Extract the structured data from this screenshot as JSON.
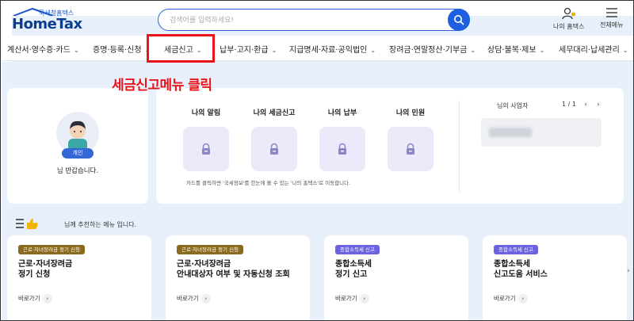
{
  "header": {
    "logo_sub": "국세청홈택스",
    "logo_main": "HomeTax",
    "search_placeholder": "검색어를 입력하세요!",
    "my_hometax": "나의 홈택스",
    "all_menu": "전체메뉴"
  },
  "nav": {
    "items": [
      {
        "label": "계산서·영수증·카드"
      },
      {
        "label": "증명·등록·신청"
      },
      {
        "label": "세금신고"
      },
      {
        "label": "납부·고지·환급"
      },
      {
        "label": "지급명세·자료·공익법인"
      },
      {
        "label": "장려금·연말정산·기부금"
      },
      {
        "label": "상담·불복·제보"
      },
      {
        "label": "세무대리·납세관리"
      }
    ]
  },
  "annotation": "세금신고메뉴 클릭",
  "profile": {
    "badge": "개인",
    "greeting": "님 반갑습니다."
  },
  "info": {
    "cols": [
      {
        "title": "나의 알림"
      },
      {
        "title": "나의 세금신고"
      },
      {
        "title": "나의 납부"
      },
      {
        "title": "나의 민원"
      }
    ],
    "note": "카드를 클릭하면 '국세정보'를 한눈에 볼 수 있는 '나의 홈택스'로 이동합니다.",
    "biz_title": "님의 사업자",
    "pager": "1 / 1"
  },
  "reco": {
    "text": "님께 추천하는 메뉴 입니다.",
    "cards": [
      {
        "tag": "근로·자녀장려금 정기 신청",
        "tag_color": "#8a6a1e",
        "title": "근로·자녀장려금\n정기 신청",
        "link": "바로가기"
      },
      {
        "tag": "근로·자녀장려금 정기 신청",
        "tag_color": "#8a6a1e",
        "title": "근로·자녀장려금\n안내대상자 여부 및 자동신청 조회",
        "link": "바로가기"
      },
      {
        "tag": "종합소득세 신고",
        "tag_color": "#6b63e0",
        "title": "종합소득세\n정기 신고",
        "link": "바로가기"
      },
      {
        "tag": "종합소득세 신고",
        "tag_color": "#6b63e0",
        "title": "종합소득세\n신고도움 서비스",
        "link": "바로가기"
      }
    ]
  },
  "colors": {
    "brand_blue": "#1d5fe0",
    "highlight_red": "#e8141a",
    "page_bg": "#e8f1fb"
  }
}
